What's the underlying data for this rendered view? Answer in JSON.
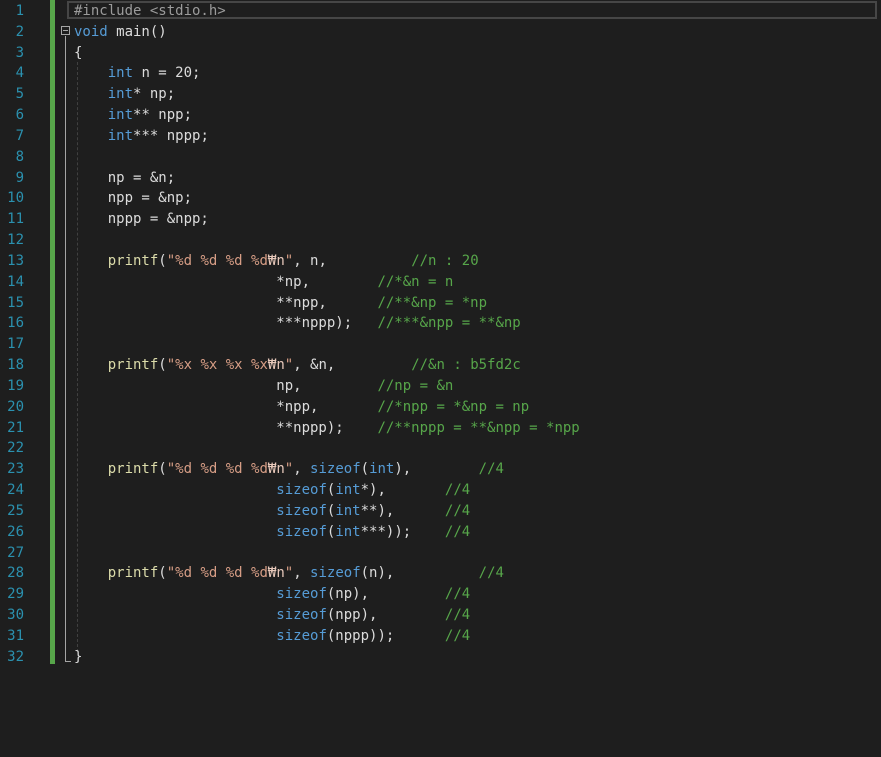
{
  "gutter": {
    "line_numbers": [
      "1",
      "2",
      "3",
      "4",
      "5",
      "6",
      "7",
      "8",
      "9",
      "10",
      "11",
      "12",
      "13",
      "14",
      "15",
      "16",
      "17",
      "18",
      "19",
      "20",
      "21",
      "22",
      "23",
      "24",
      "25",
      "26",
      "27",
      "28",
      "29",
      "30",
      "31",
      "32"
    ]
  },
  "code": {
    "lines": [
      [
        {
          "t": "#include <stdio.h>",
          "c": "pp"
        }
      ],
      [
        {
          "t": "void",
          "c": "kw"
        },
        {
          "t": " main()",
          "c": "id"
        }
      ],
      [
        {
          "t": "{",
          "c": "id"
        }
      ],
      [
        {
          "t": "    ",
          "c": "id"
        },
        {
          "t": "int",
          "c": "kw"
        },
        {
          "t": " n = 20;",
          "c": "id"
        }
      ],
      [
        {
          "t": "    ",
          "c": "id"
        },
        {
          "t": "int",
          "c": "kw"
        },
        {
          "t": "* np;",
          "c": "id"
        }
      ],
      [
        {
          "t": "    ",
          "c": "id"
        },
        {
          "t": "int",
          "c": "kw"
        },
        {
          "t": "** npp;",
          "c": "id"
        }
      ],
      [
        {
          "t": "    ",
          "c": "id"
        },
        {
          "t": "int",
          "c": "kw"
        },
        {
          "t": "*** nppp;",
          "c": "id"
        }
      ],
      [
        {
          "t": "",
          "c": "id"
        }
      ],
      [
        {
          "t": "    np = &n;",
          "c": "id"
        }
      ],
      [
        {
          "t": "    npp = &np;",
          "c": "id"
        }
      ],
      [
        {
          "t": "    nppp = &npp;",
          "c": "id"
        }
      ],
      [
        {
          "t": "",
          "c": "id"
        }
      ],
      [
        {
          "t": "    ",
          "c": "id"
        },
        {
          "t": "printf",
          "c": "fn"
        },
        {
          "t": "(",
          "c": "id"
        },
        {
          "t": "\"%d %d %d %d",
          "c": "str"
        },
        {
          "t": "₩n",
          "c": "esc"
        },
        {
          "t": "\"",
          "c": "str"
        },
        {
          "t": ", n,          ",
          "c": "id"
        },
        {
          "t": "//n : 20",
          "c": "cm"
        }
      ],
      [
        {
          "t": "                        *np,        ",
          "c": "id"
        },
        {
          "t": "//*&n = n",
          "c": "cm"
        }
      ],
      [
        {
          "t": "                        **npp,      ",
          "c": "id"
        },
        {
          "t": "//**&np = *np",
          "c": "cm"
        }
      ],
      [
        {
          "t": "                        ***nppp);   ",
          "c": "id"
        },
        {
          "t": "//***&npp = **&np",
          "c": "cm"
        }
      ],
      [
        {
          "t": "",
          "c": "id"
        }
      ],
      [
        {
          "t": "    ",
          "c": "id"
        },
        {
          "t": "printf",
          "c": "fn"
        },
        {
          "t": "(",
          "c": "id"
        },
        {
          "t": "\"%x %x %x %x",
          "c": "str"
        },
        {
          "t": "₩n",
          "c": "esc"
        },
        {
          "t": "\"",
          "c": "str"
        },
        {
          "t": ", &n,         ",
          "c": "id"
        },
        {
          "t": "//&n : b5fd2c",
          "c": "cm"
        }
      ],
      [
        {
          "t": "                        np,         ",
          "c": "id"
        },
        {
          "t": "//np = &n",
          "c": "cm"
        }
      ],
      [
        {
          "t": "                        *npp,       ",
          "c": "id"
        },
        {
          "t": "//*npp = *&np = np",
          "c": "cm"
        }
      ],
      [
        {
          "t": "                        **nppp);    ",
          "c": "id"
        },
        {
          "t": "//**nppp = **&npp = *npp",
          "c": "cm"
        }
      ],
      [
        {
          "t": "",
          "c": "id"
        }
      ],
      [
        {
          "t": "    ",
          "c": "id"
        },
        {
          "t": "printf",
          "c": "fn"
        },
        {
          "t": "(",
          "c": "id"
        },
        {
          "t": "\"%d %d %d %d",
          "c": "str"
        },
        {
          "t": "₩n",
          "c": "esc"
        },
        {
          "t": "\"",
          "c": "str"
        },
        {
          "t": ", ",
          "c": "id"
        },
        {
          "t": "sizeof",
          "c": "kw"
        },
        {
          "t": "(",
          "c": "id"
        },
        {
          "t": "int",
          "c": "kw"
        },
        {
          "t": "),        ",
          "c": "id"
        },
        {
          "t": "//4",
          "c": "cm"
        }
      ],
      [
        {
          "t": "                        ",
          "c": "id"
        },
        {
          "t": "sizeof",
          "c": "kw"
        },
        {
          "t": "(",
          "c": "id"
        },
        {
          "t": "int",
          "c": "kw"
        },
        {
          "t": "*),       ",
          "c": "id"
        },
        {
          "t": "//4",
          "c": "cm"
        }
      ],
      [
        {
          "t": "                        ",
          "c": "id"
        },
        {
          "t": "sizeof",
          "c": "kw"
        },
        {
          "t": "(",
          "c": "id"
        },
        {
          "t": "int",
          "c": "kw"
        },
        {
          "t": "**),      ",
          "c": "id"
        },
        {
          "t": "//4",
          "c": "cm"
        }
      ],
      [
        {
          "t": "                        ",
          "c": "id"
        },
        {
          "t": "sizeof",
          "c": "kw"
        },
        {
          "t": "(",
          "c": "id"
        },
        {
          "t": "int",
          "c": "kw"
        },
        {
          "t": "***));    ",
          "c": "id"
        },
        {
          "t": "//4",
          "c": "cm"
        }
      ],
      [
        {
          "t": "",
          "c": "id"
        }
      ],
      [
        {
          "t": "    ",
          "c": "id"
        },
        {
          "t": "printf",
          "c": "fn"
        },
        {
          "t": "(",
          "c": "id"
        },
        {
          "t": "\"%d %d %d %d",
          "c": "str"
        },
        {
          "t": "₩n",
          "c": "esc"
        },
        {
          "t": "\"",
          "c": "str"
        },
        {
          "t": ", ",
          "c": "id"
        },
        {
          "t": "sizeof",
          "c": "kw"
        },
        {
          "t": "(n),          ",
          "c": "id"
        },
        {
          "t": "//4",
          "c": "cm"
        }
      ],
      [
        {
          "t": "                        ",
          "c": "id"
        },
        {
          "t": "sizeof",
          "c": "kw"
        },
        {
          "t": "(np),         ",
          "c": "id"
        },
        {
          "t": "//4",
          "c": "cm"
        }
      ],
      [
        {
          "t": "                        ",
          "c": "id"
        },
        {
          "t": "sizeof",
          "c": "kw"
        },
        {
          "t": "(npp),        ",
          "c": "id"
        },
        {
          "t": "//4",
          "c": "cm"
        }
      ],
      [
        {
          "t": "                        ",
          "c": "id"
        },
        {
          "t": "sizeof",
          "c": "kw"
        },
        {
          "t": "(nppp));      ",
          "c": "id"
        },
        {
          "t": "//4",
          "c": "cm"
        }
      ],
      [
        {
          "t": "}",
          "c": "id"
        }
      ]
    ]
  },
  "colors": {
    "background": "#1e1e1e",
    "line_number": "#2b91af",
    "keyword": "#569cd6",
    "string": "#d69d85",
    "function": "#dcdcaa",
    "comment": "#57a64a",
    "change_bar": "#57a64a"
  }
}
